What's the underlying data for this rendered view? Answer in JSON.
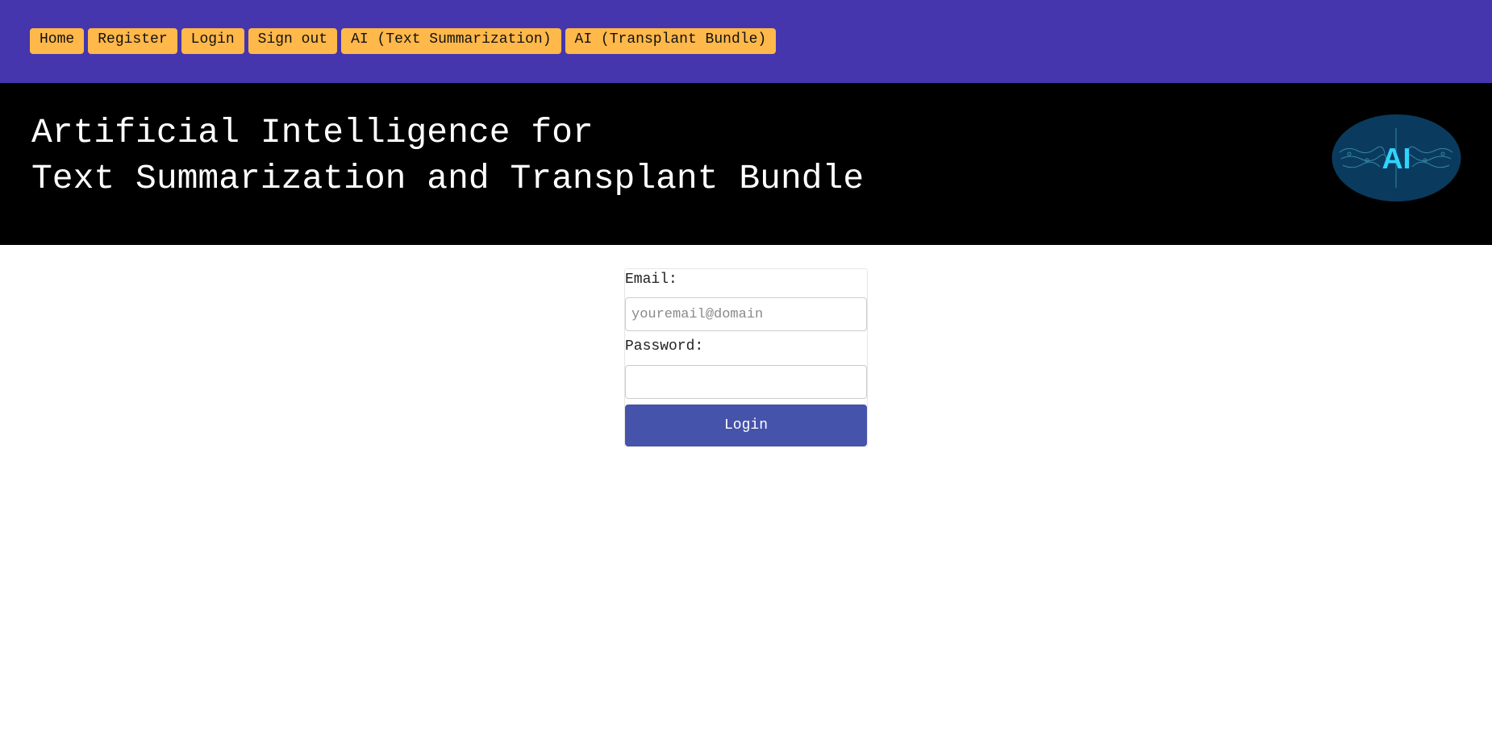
{
  "nav": {
    "items": [
      {
        "label": "Home"
      },
      {
        "label": "Register"
      },
      {
        "label": "Login"
      },
      {
        "label": "Sign out"
      },
      {
        "label": "AI (Text Summarization)"
      },
      {
        "label": "AI (Transplant Bundle)"
      }
    ]
  },
  "header": {
    "title_line1": "Artificial Intelligence for",
    "title_line2": "Text Summarization and Transplant Bundle",
    "logo_text": "AI",
    "logo_icon": "ai-brain-logo"
  },
  "login_form": {
    "email_label": "Email:",
    "email_placeholder": "youremail@domain",
    "email_value": "",
    "password_label": "Password:",
    "password_value": "",
    "submit_label": "Login"
  },
  "colors": {
    "nav_background": "#4536ad",
    "nav_button": "#ffb84a",
    "header_background": "#000000",
    "submit_button": "#4553aa",
    "logo_background": "#0a3b5e",
    "logo_text": "#2fd3ff"
  }
}
